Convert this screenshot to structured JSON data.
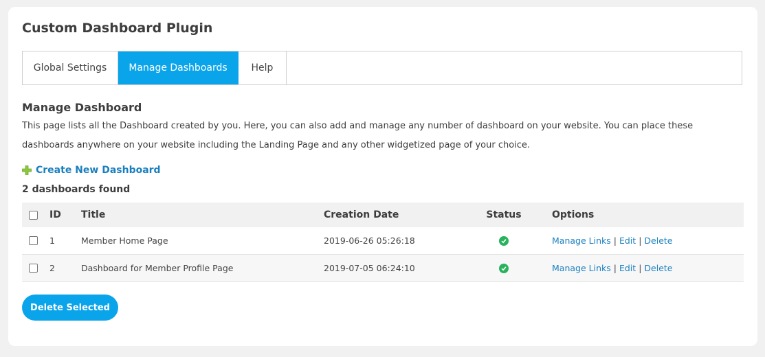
{
  "plugin_title": "Custom Dashboard Plugin",
  "tabs": [
    {
      "label": "Global Settings",
      "active": false
    },
    {
      "label": "Manage Dashboards",
      "active": true
    },
    {
      "label": "Help",
      "active": false
    }
  ],
  "section": {
    "heading": "Manage Dashboard",
    "description": "This page lists all the Dashboard created by you. Here, you can also add and manage any number of dashboard on your website. You can place these dashboards anywhere on your website including the Landing Page and any other widgetized page of your choice."
  },
  "create_link": {
    "label": "Create New Dashboard",
    "icon": "plus-icon"
  },
  "count_text": "2 dashboards found",
  "table": {
    "headers": {
      "id": "ID",
      "title": "Title",
      "date": "Creation Date",
      "status": "Status",
      "options": "Options"
    },
    "rows": [
      {
        "id": "1",
        "title": "Member Home Page",
        "date": "2019-06-26 05:26:18",
        "status": "active"
      },
      {
        "id": "2",
        "title": "Dashboard for Member Profile Page",
        "date": "2019-07-05 06:24:10",
        "status": "active"
      }
    ],
    "options": {
      "manage": "Manage Links",
      "edit": "Edit",
      "delete": "Delete",
      "separator": "|"
    }
  },
  "delete_button": "Delete Selected",
  "colors": {
    "accent": "#0aa4eb",
    "link": "#1a7fbf",
    "status_ok": "#28b25e",
    "plus": "#8dc63f"
  }
}
